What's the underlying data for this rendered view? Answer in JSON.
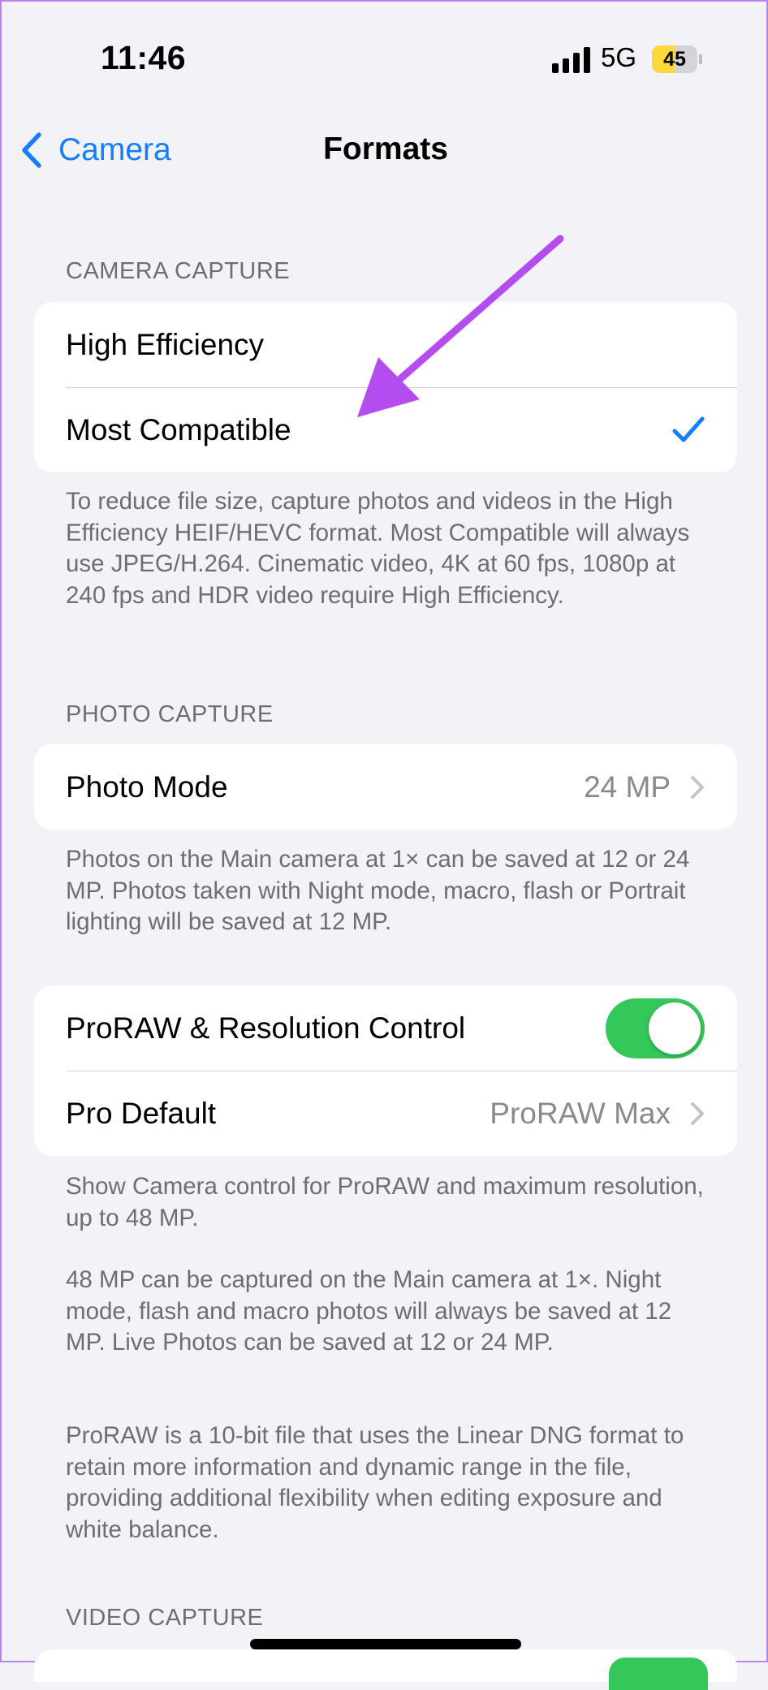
{
  "status_bar": {
    "time": "11:46",
    "network": "5G",
    "battery": "45"
  },
  "nav": {
    "back_label": "Camera",
    "title": "Formats"
  },
  "camera_capture": {
    "header": "CAMERA CAPTURE",
    "options": [
      {
        "label": "High Efficiency",
        "selected": false
      },
      {
        "label": "Most Compatible",
        "selected": true
      }
    ],
    "footnote": "To reduce file size, capture photos and videos in the High Efficiency HEIF/HEVC format. Most Compatible will always use JPEG/H.264. Cinematic video, 4K at 60 fps, 1080p at 240 fps and HDR video require High Efficiency."
  },
  "photo_capture": {
    "header": "PHOTO CAPTURE",
    "photo_mode": {
      "label": "Photo Mode",
      "value": "24 MP"
    },
    "footnote": "Photos on the Main camera at 1× can be saved at 12 or 24 MP. Photos taken with Night mode, macro, flash or Portrait lighting will be saved at 12 MP."
  },
  "proraw": {
    "toggle": {
      "label": "ProRAW & Resolution Control",
      "on": true
    },
    "pro_default": {
      "label": "Pro Default",
      "value": "ProRAW Max"
    },
    "footnotes": [
      "Show Camera control for ProRAW and maximum resolution, up to 48 MP.",
      "48 MP can be captured on the Main camera at 1×. Night mode, flash and macro photos will always be saved at 12 MP. Live Photos can be saved at 12 or 24 MP.",
      "ProRAW is a 10-bit file that uses the Linear DNG format to retain more information and dynamic range in the file, providing additional flexibility when editing exposure and white balance."
    ]
  },
  "video_capture": {
    "header": "VIDEO CAPTURE"
  },
  "colors": {
    "accent": "#157efb",
    "toggle_on": "#34c759",
    "annotation_arrow": "#b44cf0",
    "background": "#f2f2f7"
  },
  "icons": [
    "signal-icon",
    "battery-icon",
    "chevron-left-icon",
    "checkmark-icon",
    "chevron-right-icon",
    "annotation-arrow-icon"
  ]
}
